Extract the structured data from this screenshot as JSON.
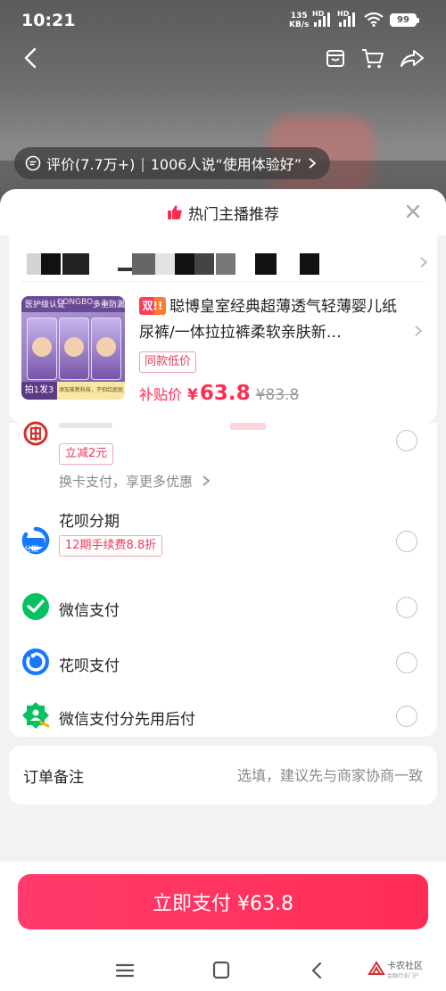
{
  "status_bar": {
    "time": "10:21",
    "net_speed_value": "135",
    "net_speed_unit": "KB/s",
    "hd_label": "HD",
    "battery": "99"
  },
  "top_nav": {
    "back_icon": "chevron-left-icon",
    "store_icon": "store-icon",
    "cart_icon": "cart-icon",
    "share_icon": "share-icon"
  },
  "review_pill": {
    "review_text": "评价(7.7万+)",
    "separator": "|",
    "experience_text": "1006人说“使用体验好”"
  },
  "sheet": {
    "title": "热门主播推荐",
    "title_icon": "thumbs-up-icon",
    "close_icon": "close-icon"
  },
  "product": {
    "double_tag": "双!!",
    "title": "聪博皇室经典超薄透气轻薄婴儿纸尿裤/一体拉拉裤柔软亲肤新…",
    "same_low_tag": "同款低价",
    "price_label": "补贴价",
    "currency": "¥",
    "price": "63.8",
    "original_price": "¥83.8",
    "image": {
      "banner_left": "医护级认证",
      "banner_mid": "CONGBO",
      "banner_right": "多重防漏",
      "promo_tag": "拍1发3",
      "footer_text": "添加革新科技，不怕红屁屁"
    }
  },
  "payment": {
    "items": [
      {
        "icon": "bank-card-icon",
        "badge": "立减2元",
        "sub": "换卡支付，享更多优惠"
      },
      {
        "icon": "huabei-installment-icon",
        "icon_text": "分期",
        "name": "花呗分期",
        "badge": "12期手续费8.8折"
      },
      {
        "icon": "wechat-pay-icon",
        "name": "微信支付"
      },
      {
        "icon": "huabei-pay-icon",
        "name": "花呗支付"
      },
      {
        "icon": "wechat-pay-later-icon",
        "name": "微信支付分先用后付"
      }
    ]
  },
  "remark": {
    "label": "订单备注",
    "placeholder": "选填，建议先与商家协商一致"
  },
  "footer": {
    "pay_button": "立即支付 ¥63.8",
    "watermark_title": "卡农社区",
    "watermark_sub": "金融行业门户"
  },
  "colors": {
    "accent": "#ff2d55",
    "badge_text": "#e93a5b",
    "wechat_green": "#07c160",
    "alipay_blue": "#1677ff"
  }
}
